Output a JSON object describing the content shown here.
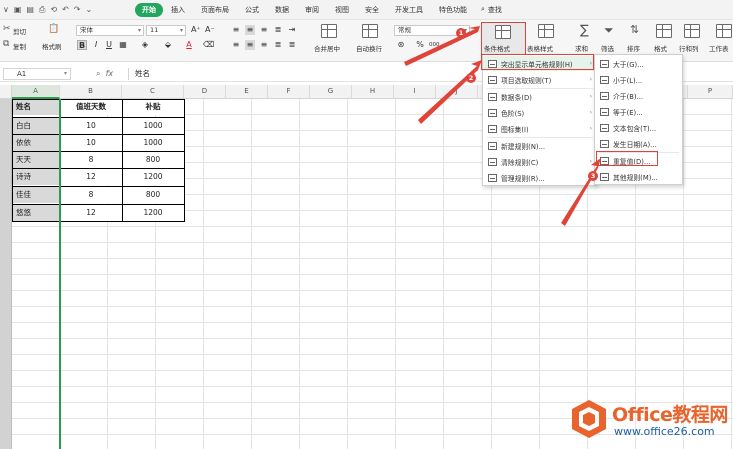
{
  "menubar": {
    "quick_access": [
      "∨",
      "▣",
      "▤",
      "⎙",
      "⟲",
      "↶",
      "↷",
      "⌄"
    ],
    "tabs": [
      "开始",
      "插入",
      "页面布局",
      "公式",
      "数据",
      "审阅",
      "视图",
      "安全",
      "开发工具",
      "特色功能"
    ],
    "active_tab": "开始",
    "search_label": "查找"
  },
  "ribbon": {
    "cut": "剪切",
    "copy": "复制",
    "format_painter": "格式刷",
    "paste": "粘贴",
    "font_name": "宋体",
    "font_size": "11",
    "bold": "B",
    "italic": "I",
    "underline": "U",
    "font_color_letter": "A",
    "grow_font": "A⁺",
    "shrink_font": "A⁻",
    "merge_center": "合并居中",
    "wrap_text": "自动换行",
    "number_format": "常规",
    "percent": "%",
    "thousands": "000",
    "decimals": "⁺⁰",
    "conditional_format": "条件格式",
    "table_style": "表格样式",
    "sum": "求和",
    "filter": "筛选",
    "sort": "排序",
    "format": "格式",
    "rows_cols": "行和列",
    "worksheet": "工作表",
    "accent_color": "#23a65f"
  },
  "formula_bar": {
    "cell_ref": "A1",
    "fx_label": "fx",
    "zoom_icon": "magnifier-icon",
    "content": "姓名"
  },
  "sheet": {
    "columns": [
      "A",
      "B",
      "C",
      "D",
      "E",
      "F",
      "G",
      "H",
      "I",
      "J",
      "K",
      "L",
      "M",
      "N",
      "O",
      "P"
    ],
    "selected_column": "A",
    "table_header": [
      "姓名",
      "值班天数",
      "补贴"
    ],
    "rows": [
      [
        "白白",
        "10",
        "1000"
      ],
      [
        "依依",
        "10",
        "1000"
      ],
      [
        "天天",
        "8",
        "800"
      ],
      [
        "诗诗",
        "12",
        "1200"
      ],
      [
        "佳佳",
        "8",
        "800"
      ],
      [
        "悠悠",
        "12",
        "1200"
      ]
    ]
  },
  "cf_menu": {
    "items": [
      {
        "label": "突出显示单元格规则(H)",
        "icon": "highlight-rules-icon",
        "submenu": true
      },
      {
        "label": "项目选取规则(T)",
        "icon": "top-bottom-rules-icon",
        "submenu": true
      },
      {
        "label": "数据条(D)",
        "icon": "data-bars-icon",
        "submenu": true
      },
      {
        "label": "色阶(S)",
        "icon": "color-scales-icon",
        "submenu": true
      },
      {
        "label": "图标集(I)",
        "icon": "icon-sets-icon",
        "submenu": true
      },
      {
        "label": "新建规则(N)...",
        "icon": "new-rule-icon",
        "submenu": false
      },
      {
        "label": "清除规则(C)",
        "icon": "clear-rules-icon",
        "submenu": true
      },
      {
        "label": "管理规则(R)...",
        "icon": "manage-rules-icon",
        "submenu": false
      }
    ]
  },
  "highlight_submenu": {
    "items": [
      {
        "label": "大于(G)...",
        "icon": "greater-than-icon"
      },
      {
        "label": "小于(L)...",
        "icon": "less-than-icon"
      },
      {
        "label": "介于(B)...",
        "icon": "between-icon"
      },
      {
        "label": "等于(E)...",
        "icon": "equal-to-icon"
      },
      {
        "label": "文本包含(T)...",
        "icon": "text-contains-icon"
      },
      {
        "label": "发生日期(A)...",
        "icon": "date-occurring-icon"
      },
      {
        "label": "重复值(D)...",
        "icon": "duplicate-values-icon"
      },
      {
        "label": "其他规则(M)...",
        "icon": "more-rules-icon"
      }
    ]
  },
  "annotations": {
    "step1": "1",
    "step2": "2",
    "step3": "3",
    "color": "#e0433a"
  },
  "watermark": {
    "title": "Office教程网",
    "url": "www.office26.com",
    "title_color": "#e8642c",
    "url_color": "#1e5fa5"
  }
}
